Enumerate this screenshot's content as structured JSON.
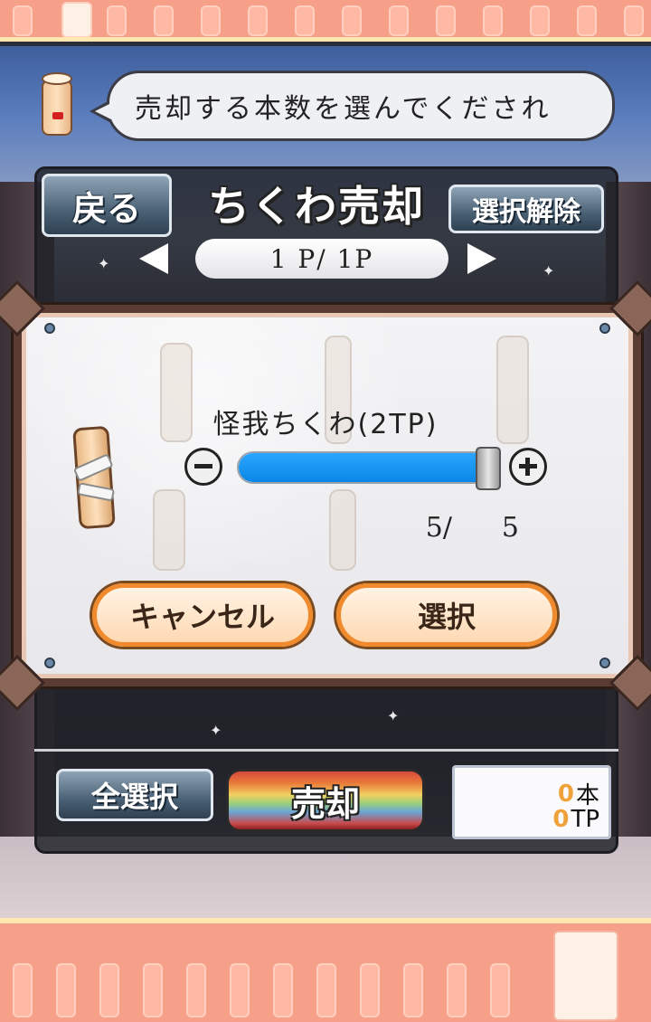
{
  "speech": {
    "text": "売却する本数を選んでくだされ"
  },
  "header": {
    "back_label": "戻る",
    "title": "ちくわ売却",
    "deselect_label": "選択解除"
  },
  "pager": {
    "text": "1 P/  1P"
  },
  "dialog": {
    "item_name": "怪我ちくわ(2TP)",
    "quantity": {
      "current": "5/",
      "max": "5",
      "fill_fraction": 1.0
    },
    "cancel_label": "キャンセル",
    "select_label": "選択"
  },
  "footer": {
    "select_all_label": "全選択",
    "sell_label": "売却",
    "totals": {
      "count_value": "0",
      "count_unit": "本",
      "tp_value": "0",
      "tp_unit": "TP"
    }
  },
  "colors": {
    "slider_fill": "#0a86e6",
    "button_accent": "#f08a2c",
    "band": "#f6a08a"
  }
}
